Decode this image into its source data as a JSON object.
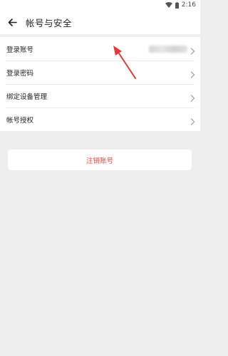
{
  "status_bar": {
    "time": "2:16",
    "icons": [
      "wifi-icon",
      "battery-icon"
    ]
  },
  "header": {
    "title": "帐号与安全",
    "back_icon": "arrow-left-icon"
  },
  "settings": {
    "items": [
      {
        "label": "登录账号",
        "value_redacted": true
      },
      {
        "label": "登录密码"
      },
      {
        "label": "绑定设备管理"
      },
      {
        "label": "帐号授权"
      }
    ]
  },
  "actions": {
    "cancel_account_label": "注销账号"
  },
  "colors": {
    "background": "#eeeeee",
    "surface": "#ffffff",
    "danger_text": "#e2463d",
    "annotation_arrow": "#e53935"
  }
}
